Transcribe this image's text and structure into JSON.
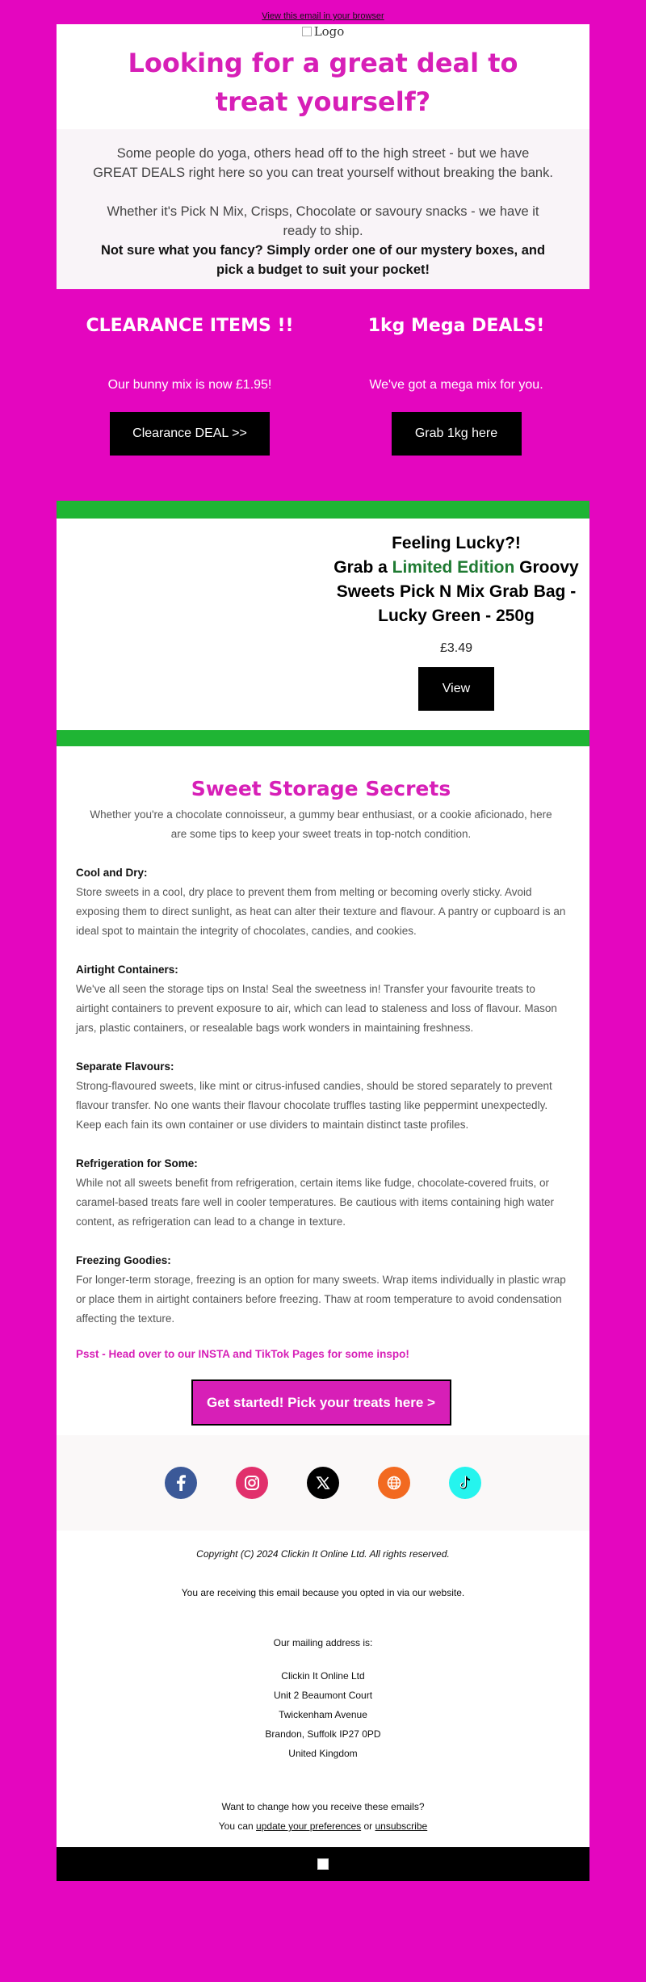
{
  "preheader": {
    "view_in_browser": "View this email in your browser"
  },
  "logo": {
    "alt": "Logo"
  },
  "hero": {
    "title": "Looking for a great deal to treat yourself?",
    "p1": "Some people do yoga, others head off to the high street - but we have GREAT DEALS right here so you can treat yourself without breaking the bank.",
    "p2": "Whether it's Pick N Mix, Crisps, Chocolate or savoury snacks - we have it ready to ship.",
    "p3": "Not sure what you fancy? Simply order one of our mystery boxes, and pick a budget to suit your pocket!"
  },
  "deals": [
    {
      "title": "CLEARANCE ITEMS !!",
      "text": "Our bunny mix is now £1.95!",
      "button": "Clearance DEAL >>"
    },
    {
      "title": "1kg Mega DEALS!",
      "text": "We've got a mega mix for you.",
      "button": "Grab 1kg here"
    }
  ],
  "promo": {
    "line1": "Feeling Lucky?!",
    "line2_pre": "Grab a ",
    "line2_highlight": "Limited Edition",
    "line2_post": " Groovy Sweets Pick N Mix Grab Bag - Lucky Green - 250g",
    "price": "£3.49",
    "button": "View",
    "accent_color": "#1fb534"
  },
  "storage": {
    "title": "Sweet Storage Secrets",
    "lead": "Whether you're a chocolate connoisseur, a gummy bear enthusiast, or a cookie aficionado, here are some tips to keep your sweet treats in top-notch condition.",
    "tips": [
      {
        "heading": "Cool and Dry:",
        "body": "Store sweets in a cool, dry place to prevent them from melting or becoming overly sticky. Avoid exposing them to direct sunlight, as heat can alter their texture and flavour. A pantry or cupboard is an ideal spot to maintain the integrity of chocolates, candies, and cookies."
      },
      {
        "heading": "Airtight Containers:",
        "body": "We've all seen the storage tips on Insta! Seal the sweetness in! Transfer your favourite treats to airtight containers to prevent exposure to air, which can lead to staleness and loss of flavour. Mason jars, plastic containers, or resealable bags work wonders in maintaining freshness."
      },
      {
        "heading": "Separate Flavours:",
        "body": "Strong-flavoured sweets, like mint or citrus-infused candies, should be stored separately to prevent flavour transfer. No one wants their flavour chocolate truffles tasting like peppermint unexpectedly. Keep each fain its own container or use dividers to maintain distinct taste profiles."
      },
      {
        "heading": "Refrigeration for Some:",
        "body": "While not all sweets benefit from refrigeration, certain items like fudge, chocolate-covered fruits, or caramel-based treats fare well in cooler temperatures. Be cautious with items containing high water content, as refrigeration can lead to a change in texture."
      },
      {
        "heading": "Freezing Goodies:",
        "body": "For longer-term storage, freezing is an option for many sweets. Wrap items individually in plastic wrap or place them in airtight containers before freezing. Thaw at room temperature to avoid condensation affecting the texture."
      }
    ],
    "psst": "Psst - Head over to our INSTA and TikTok Pages for some inspo!",
    "cta": "Get started! Pick your treats here >"
  },
  "social": [
    "facebook-icon",
    "instagram-icon",
    "x-icon",
    "website-icon",
    "tiktok-icon"
  ],
  "footer": {
    "copyright": "Copyright (C) 2024 Clickin It Online Ltd. All rights reserved.",
    "reason": "You are receiving this email because you opted in via our website.",
    "mailing_label": "Our mailing address is:",
    "address": [
      "Clickin It Online Ltd",
      "Unit 2 Beaumont Court",
      "Twickenham Avenue",
      "Brandon, Suffolk IP27 0PD",
      "United Kingdom"
    ],
    "change_q": "Want to change how you receive these emails?",
    "you_can": "You can ",
    "update_prefs": "update your preferences",
    "or": " or ",
    "unsubscribe": "unsubscribe"
  },
  "colors": {
    "background": "#e406bf",
    "brand_pink": "#d71fb7",
    "promo_green": "#1fb534"
  }
}
